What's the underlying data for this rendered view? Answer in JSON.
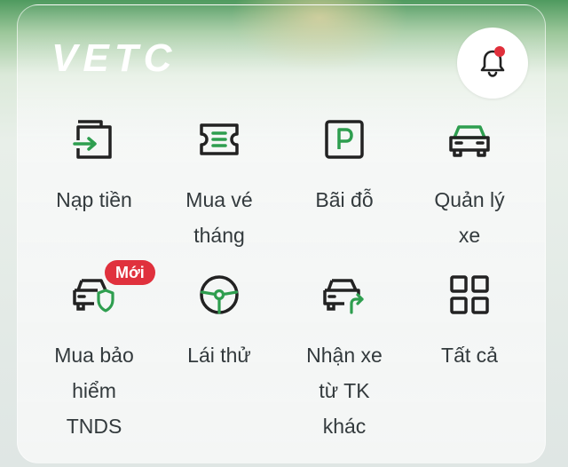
{
  "brand": {
    "logo_text": "VETC"
  },
  "header": {
    "notification_has_unread": true
  },
  "menu": {
    "items": [
      {
        "label_lines": [
          "Nạp tiền"
        ],
        "icon": "wallet-topup-icon"
      },
      {
        "label_lines": [
          "Mua vé",
          "tháng"
        ],
        "icon": "ticket-icon"
      },
      {
        "label_lines": [
          "Bãi đỗ"
        ],
        "icon": "parking-icon"
      },
      {
        "label_lines": [
          "Quản lý",
          "xe"
        ],
        "icon": "car-icon"
      },
      {
        "label_lines": [
          "Mua bảo",
          "hiểm",
          "TNDS"
        ],
        "icon": "car-shield-icon",
        "badge": "Mới"
      },
      {
        "label_lines": [
          "Lái thử"
        ],
        "icon": "steering-wheel-icon"
      },
      {
        "label_lines": [
          "Nhận xe",
          "từ TK",
          "khác"
        ],
        "icon": "car-transfer-icon"
      },
      {
        "label_lines": [
          "Tất cả"
        ],
        "icon": "grid-all-icon"
      }
    ]
  },
  "colors": {
    "accent_green": "#2e9e4f",
    "icon_dark": "#222222",
    "badge_red": "#e0313d"
  }
}
